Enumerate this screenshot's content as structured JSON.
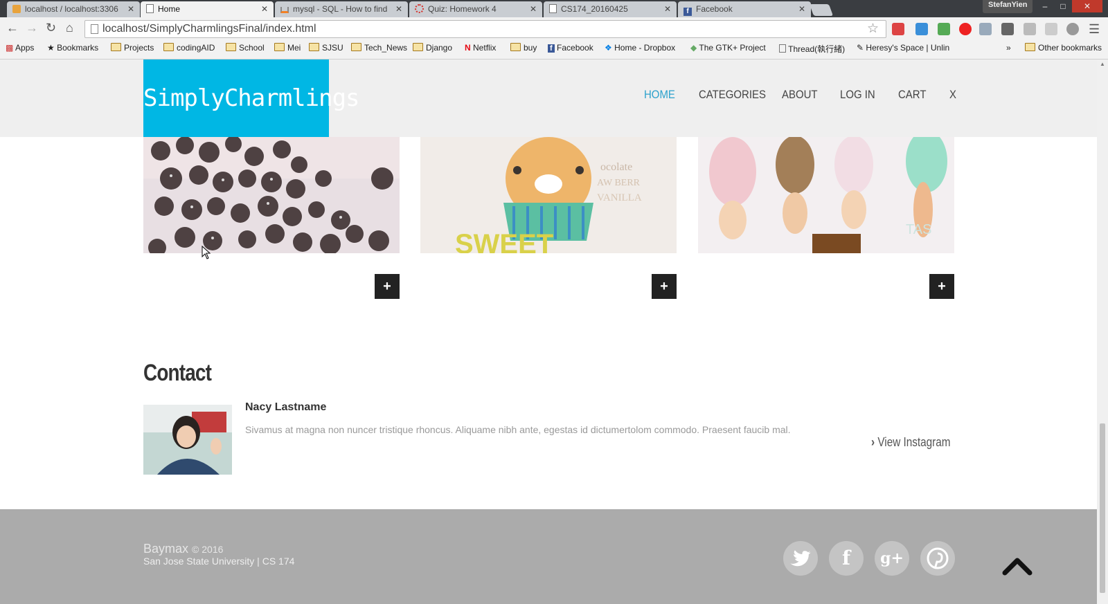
{
  "browser": {
    "tabs": [
      {
        "title": "localhost / localhost:3306",
        "active": false
      },
      {
        "title": "Home",
        "active": true
      },
      {
        "title": "mysql - SQL - How to find",
        "active": false
      },
      {
        "title": "Quiz: Homework 4",
        "active": false
      },
      {
        "title": "CS174_20160425",
        "active": false
      },
      {
        "title": "Facebook",
        "active": false
      }
    ],
    "profile_name": "StefanYien",
    "url": "localhost/SimplyCharmlingsFinal/index.html",
    "bookmarks": [
      "Apps",
      "Bookmarks",
      "Projects",
      "codingAID",
      "School",
      "Mei",
      "SJSU",
      "Tech_News",
      "Django",
      "Netflix",
      "buy",
      "Facebook",
      "Home - Dropbox",
      "The GTK+ Project",
      "Thread(執行緒)",
      "Heresy's Space | Unlin"
    ],
    "other_bookmarks": "Other bookmarks",
    "overflow": "»"
  },
  "site": {
    "logo": "SimplyCharmlings",
    "nav": [
      "HOME",
      "CATEGORIES",
      "ABOUT",
      "LOG IN",
      "CART",
      "X"
    ],
    "plus_label": "+",
    "contact": {
      "title": "Contact",
      "name": "Nacy Lastname",
      "description": "Sivamus at magna non nuncer tristique rhoncus. Aliquame nibh ante, egestas id dictumertolom commodo. Praesent faucib mal.",
      "link": "View Instagram"
    },
    "footer": {
      "brand": "Baymax",
      "copyright": "© 2016",
      "school": "San Jose State University | CS 174",
      "social": [
        "twitter-icon",
        "facebook-icon",
        "google-plus-icon",
        "pinterest-icon"
      ]
    }
  },
  "colors": {
    "accent": "#00b7e4",
    "nav_active": "#2ba1cc",
    "footer_bg": "#ababab"
  }
}
